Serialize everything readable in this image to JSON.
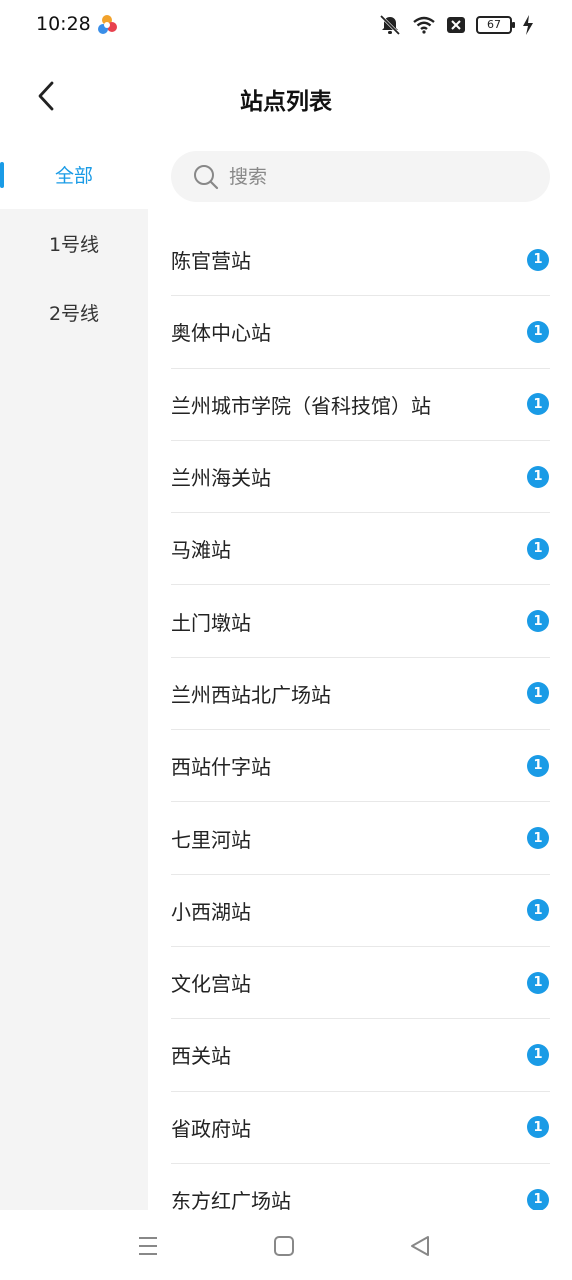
{
  "status_bar": {
    "time": "10:28",
    "battery": "67",
    "icons": [
      "app-logo-icon",
      "mute-icon",
      "wifi-icon",
      "sim-off-icon",
      "battery-icon",
      "charging-icon"
    ]
  },
  "header": {
    "title": "站点列表",
    "back_icon": "back-arrow-icon"
  },
  "sidebar": {
    "items": [
      {
        "label": "全部",
        "active": true
      },
      {
        "label": "1号线",
        "active": false
      },
      {
        "label": "2号线",
        "active": false
      }
    ]
  },
  "search": {
    "placeholder": "搜索",
    "value": ""
  },
  "stations": [
    {
      "name": "陈官营站",
      "badge": "1"
    },
    {
      "name": "奥体中心站",
      "badge": "1"
    },
    {
      "name": "兰州城市学院（省科技馆）站",
      "badge": "1"
    },
    {
      "name": "兰州海关站",
      "badge": "1"
    },
    {
      "name": "马滩站",
      "badge": "1"
    },
    {
      "name": "土门墩站",
      "badge": "1"
    },
    {
      "name": "兰州西站北广场站",
      "badge": "1"
    },
    {
      "name": "西站什字站",
      "badge": "1"
    },
    {
      "name": "七里河站",
      "badge": "1"
    },
    {
      "name": "小西湖站",
      "badge": "1"
    },
    {
      "name": "文化宫站",
      "badge": "1"
    },
    {
      "name": "西关站",
      "badge": "1"
    },
    {
      "name": "省政府站",
      "badge": "1"
    },
    {
      "name": "东方红广场站",
      "badge": "1"
    }
  ],
  "colors": {
    "accent": "#1a9be6",
    "sidebar_bg": "#f4f4f4",
    "divider": "#e8e8e8"
  },
  "nav_bar": {
    "icons": [
      "menu-icon",
      "home-icon",
      "back-triangle-icon"
    ]
  }
}
